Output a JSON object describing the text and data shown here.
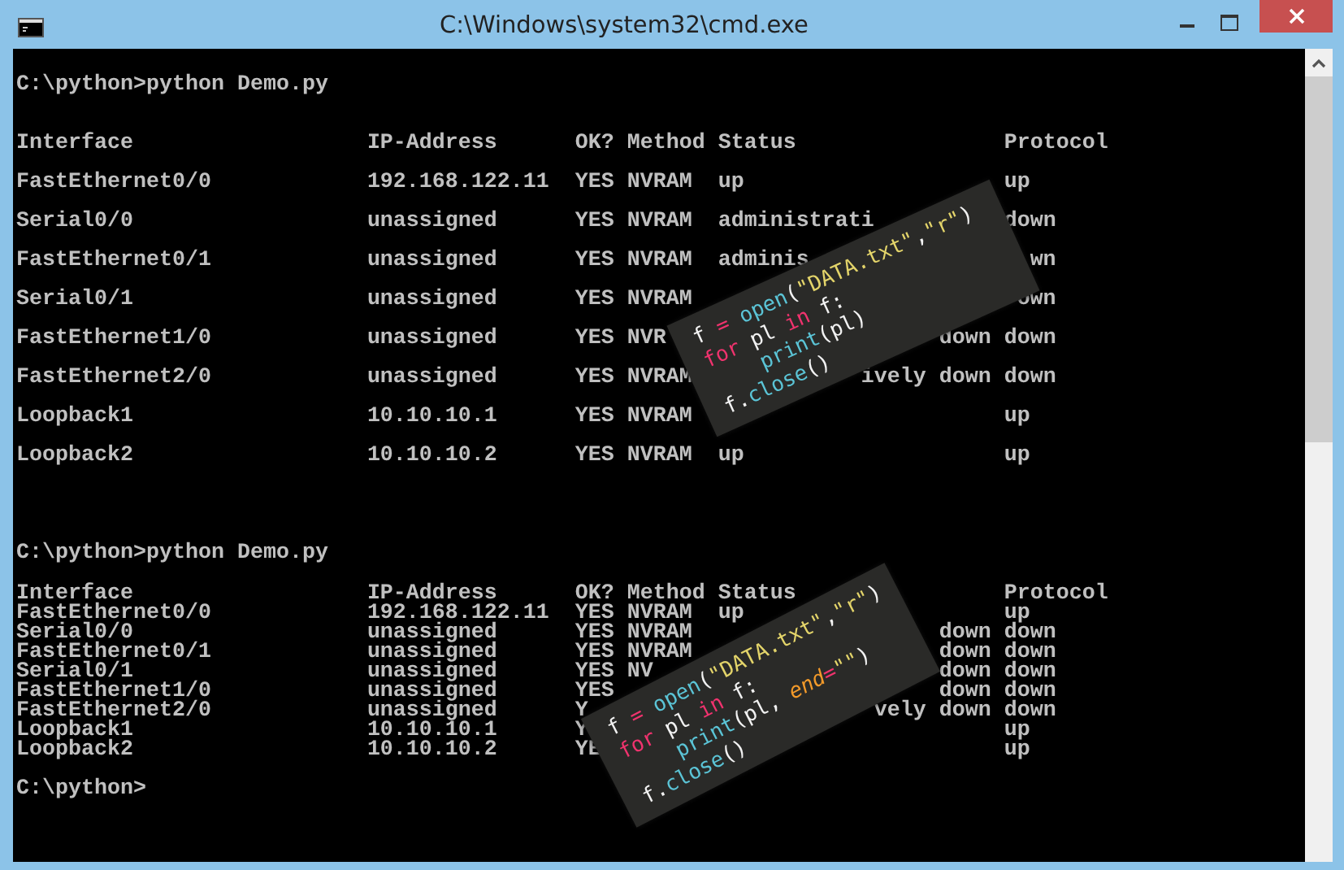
{
  "window": {
    "title": "C:\\Windows\\system32\\cmd.exe"
  },
  "console": [
    {
      "kind": "prompt",
      "text": "C:\\python>python Demo.py"
    },
    {
      "kind": "table",
      "double_spaced": true,
      "rows": [
        [
          {
            "text": "Interface"
          },
          {
            "text": "IP-Address"
          },
          {
            "text": "OK?"
          },
          {
            "text": "Method"
          },
          {
            "text": "Status"
          },
          {
            "text": "Protocol"
          }
        ],
        [
          {
            "text": "FastEthernet0/0"
          },
          {
            "text": "192.168.122.11"
          },
          {
            "text": "YES"
          },
          {
            "text": "NVRAM"
          },
          {
            "text": "up"
          },
          {
            "text": "up"
          }
        ],
        [
          {
            "text": "Serial0/0"
          },
          {
            "text": "unassigned"
          },
          {
            "text": "YES"
          },
          {
            "text": "NVRAM"
          },
          {
            "text": "administrati"
          },
          {
            "text": "down"
          }
        ],
        [
          {
            "text": "FastEthernet0/1"
          },
          {
            "text": "unassigned"
          },
          {
            "text": "YES"
          },
          {
            "text": "NVRAM"
          },
          {
            "text": "adminis"
          },
          {
            "text": "wn",
            "cut_start": true
          }
        ],
        [
          {
            "text": "Serial0/1"
          },
          {
            "text": "unassigned"
          },
          {
            "text": "YES"
          },
          {
            "text": "NVRAM"
          },
          null,
          {
            "text": "own",
            "cut_start": true
          }
        ],
        [
          {
            "text": "FastEthernet1/0"
          },
          {
            "text": "unassigned"
          },
          {
            "text": "YES"
          },
          {
            "text": "NVR"
          },
          {
            "text": "down",
            "cut_start": true
          },
          {
            "text": "down"
          }
        ],
        [
          {
            "text": "FastEthernet2/0"
          },
          {
            "text": "unassigned"
          },
          {
            "text": "YES"
          },
          {
            "text": "NVRAM"
          },
          {
            "text": "ively down",
            "cut_start": true
          },
          {
            "text": "down"
          }
        ],
        [
          {
            "text": "Loopback1"
          },
          {
            "text": "10.10.10.1"
          },
          {
            "text": "YES"
          },
          {
            "text": "NVRAM"
          },
          null,
          {
            "text": "up"
          }
        ],
        [
          {
            "text": "Loopback2"
          },
          {
            "text": "10.10.10.2"
          },
          {
            "text": "YES"
          },
          {
            "text": "NVRAM"
          },
          {
            "text": "up"
          },
          {
            "text": "up"
          }
        ]
      ]
    },
    {
      "kind": "prompt",
      "text": "C:\\python>python Demo.py"
    },
    {
      "kind": "table",
      "double_spaced": false,
      "rows": [
        [
          {
            "text": "Interface"
          },
          {
            "text": "IP-Address"
          },
          {
            "text": "OK?"
          },
          {
            "text": "Method"
          },
          {
            "text": "Status"
          },
          {
            "text": "Protocol"
          }
        ],
        [
          {
            "text": "FastEthernet0/0"
          },
          {
            "text": "192.168.122.11"
          },
          {
            "text": "YES"
          },
          {
            "text": "NVRAM"
          },
          {
            "text": "up"
          },
          {
            "text": "up"
          }
        ],
        [
          {
            "text": "Serial0/0"
          },
          {
            "text": "unassigned"
          },
          {
            "text": "YES"
          },
          {
            "text": "NVRAM"
          },
          {
            "text": "down",
            "cut_start": true
          },
          {
            "text": "down"
          }
        ],
        [
          {
            "text": "FastEthernet0/1"
          },
          {
            "text": "unassigned"
          },
          {
            "text": "YES"
          },
          {
            "text": "NVRAM"
          },
          {
            "text": "down",
            "cut_start": true
          },
          {
            "text": "down"
          }
        ],
        [
          {
            "text": "Serial0/1"
          },
          {
            "text": "unassigned"
          },
          {
            "text": "YES"
          },
          {
            "text": "NV"
          },
          {
            "text": "down",
            "cut_start": true
          },
          {
            "text": "down"
          }
        ],
        [
          {
            "text": "FastEthernet1/0"
          },
          {
            "text": "unassigned"
          },
          {
            "text": "YES"
          },
          null,
          {
            "text": "down",
            "cut_start": true
          },
          {
            "text": "down"
          }
        ],
        [
          {
            "text": "FastEthernet2/0"
          },
          {
            "text": "unassigned"
          },
          {
            "text": "Y"
          },
          null,
          {
            "text": "vely down",
            "cut_start": true
          },
          {
            "text": "down"
          }
        ],
        [
          {
            "text": "Loopback1"
          },
          {
            "text": "10.10.10.1"
          },
          {
            "text": "Y"
          },
          null,
          null,
          {
            "text": "up"
          }
        ],
        [
          {
            "text": "Loopback2"
          },
          {
            "text": "10.10.10.2"
          },
          {
            "text": "YE"
          },
          null,
          null,
          {
            "text": "up"
          }
        ]
      ]
    },
    {
      "kind": "prompt",
      "text": "C:\\python>"
    }
  ],
  "code_snippets": [
    {
      "lines": [
        {
          "indented": false,
          "tokens": [
            {
              "text": "f ",
              "kind": "plain"
            },
            {
              "text": "=",
              "kind": "keyword"
            },
            {
              "text": " open",
              "kind": "func"
            },
            {
              "text": "(",
              "kind": "plain"
            },
            {
              "text": "\"DATA.txt\"",
              "kind": "string"
            },
            {
              "text": ",",
              "kind": "plain"
            },
            {
              "text": "\"r\"",
              "kind": "string"
            },
            {
              "text": ")",
              "kind": "plain"
            }
          ]
        },
        {
          "indented": false,
          "tokens": [
            {
              "text": "for",
              "kind": "keyword"
            },
            {
              "text": " pl ",
              "kind": "plain"
            },
            {
              "text": "in",
              "kind": "keyword"
            },
            {
              "text": " f:",
              "kind": "plain"
            }
          ]
        },
        {
          "indented": true,
          "tokens": [
            {
              "text": "print",
              "kind": "func"
            },
            {
              "text": "(pl)",
              "kind": "plain"
            }
          ]
        },
        {
          "indented": false,
          "tokens": [
            {
              "text": "f.",
              "kind": "plain"
            },
            {
              "text": "close",
              "kind": "func"
            },
            {
              "text": "()",
              "kind": "plain"
            }
          ]
        }
      ]
    },
    {
      "lines": [
        {
          "indented": false,
          "tokens": [
            {
              "text": "f ",
              "kind": "plain"
            },
            {
              "text": "=",
              "kind": "keyword"
            },
            {
              "text": " open",
              "kind": "func"
            },
            {
              "text": "(",
              "kind": "plain"
            },
            {
              "text": "\"DATA.txt\"",
              "kind": "string"
            },
            {
              "text": ",",
              "kind": "plain"
            },
            {
              "text": "\"r\"",
              "kind": "string"
            },
            {
              "text": ")",
              "kind": "plain"
            }
          ]
        },
        {
          "indented": false,
          "tokens": [
            {
              "text": "for",
              "kind": "keyword"
            },
            {
              "text": " pl ",
              "kind": "plain"
            },
            {
              "text": "in",
              "kind": "keyword"
            },
            {
              "text": " f:",
              "kind": "plain"
            }
          ]
        },
        {
          "indented": true,
          "tokens": [
            {
              "text": "print",
              "kind": "func"
            },
            {
              "text": "(pl, ",
              "kind": "plain"
            },
            {
              "text": "end",
              "kind": "param"
            },
            {
              "text": "=",
              "kind": "keyword"
            },
            {
              "text": "\"\"",
              "kind": "string"
            },
            {
              "text": ")",
              "kind": "plain"
            }
          ]
        },
        {
          "indented": false,
          "tokens": [
            {
              "text": "f.",
              "kind": "plain"
            },
            {
              "text": "close",
              "kind": "func"
            },
            {
              "text": "()",
              "kind": "plain"
            }
          ]
        }
      ]
    }
  ]
}
